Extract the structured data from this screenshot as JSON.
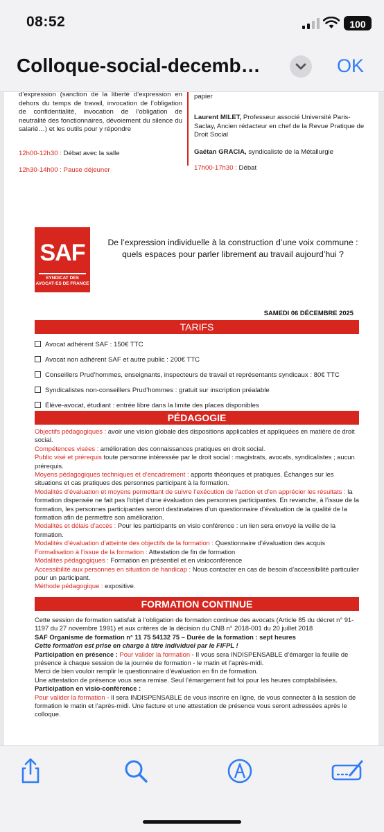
{
  "status": {
    "time": "08:52",
    "battery": "100"
  },
  "nav": {
    "title": "Colloque-social-decemb…",
    "ok_label": "OK"
  },
  "page1": {
    "left_text": "d’expression (sanction de la liberté d’expression en dehors du temps de travail, invocation de l’obligation de confidentialité, invocation de l’obligation de neutralité des fonctionnaires, dévoiement du silence du salarié…) et les outils pour y répondre",
    "slot1_time": "12h00-12h30 :",
    "slot1_label": " Débat avec la salle",
    "slot2": "12h30-14h00 : Pause déjeuner",
    "right_text": "accord avec l’employeur, au tract papier et à son affichage papier",
    "speaker1_name": "Laurent MILET,",
    "speaker1_desc": " Professeur associé Université Paris-Saclay, Ancien rédacteur en chef de la Revue Pratique de Droit Social",
    "speaker2_name": "Gaétan GRACIA,",
    "speaker2_desc": " syndicaliste de la Métallurgie",
    "slot3_time": "17h00-17h30 :",
    "slot3_label": " Débat"
  },
  "logo": {
    "big": "SAF",
    "line1": "SYNDICAT DES",
    "line2": "AVOCAT·ES DE FRANCE"
  },
  "headline": {
    "line1": "De l’expression individuelle à la construction d’une voix commune :",
    "line2": "quels espaces pour parler librement au travail aujourd’hui ?"
  },
  "date": "SAMEDI 06 DÉCEMBRE 2025",
  "tarifs": {
    "title": "TARIFS",
    "items": [
      "Avocat adhérent SAF : 150€ TTC",
      "Avocat non adhérent SAF et autre public : 200€ TTC",
      "Conseillers Prud’hommes, enseignants, inspecteurs de travail et représentants syndicaux : 80€ TTC",
      "Syndicalistes non-conseillers Prud’hommes : gratuit sur inscription préalable",
      "Élève-avocat, étudiant : entrée libre dans la limite des places disponibles"
    ]
  },
  "pedagogie": {
    "title": "PÉDAGOGIE",
    "items": [
      {
        "label": "Objectifs pédagogiques :",
        "text": " avoir une vision globale des dispositions applicables et appliquées en matière de droit social."
      },
      {
        "label": "Compétences visées :",
        "text": " amélioration des connaissances pratiques en droit social."
      },
      {
        "label": "Public visé et prérequis",
        "text": "  toute personne intéressée par le droit social : magistrats, avocats, syndicalistes ; aucun prérequis."
      },
      {
        "label": "Moyens pédagogiques techniques et d’encadrement :",
        "text": " apports théoriques et pratiques. Échanges sur les situations et cas pratiques des personnes participant à la formation."
      },
      {
        "label": "Modalités d’évaluation et moyens permettant de suivre l’exécution de l’action et d’en apprécier les résultats :",
        "text": " la formation dispensée ne fait pas l’objet d’une évaluation des personnes participantes. En revanche, à l’issue de la formation, les personnes participantes seront destinataires d’un questionnaire d’évaluation de la qualité de la formation afin de permettre son amélioration."
      },
      {
        "label": "Modalités et délais d’accès :",
        "text": " Pour les participants en visio conférence : un lien sera envoyé la veille de la formation."
      },
      {
        "label": "Modalités d’évaluation d’atteinte des objectifs de la formation :",
        "text": " Questionnaire d’évaluation des acquis"
      },
      {
        "label": "Formalisation à l’issue de la formation :",
        "text": " Attestation de fin de formation"
      },
      {
        "label": "Modalités pédagogiques :",
        "text": " Formation en présentiel et en visioconférence"
      },
      {
        "label": "Accessibilité aux personnes en situation de handicap :",
        "text": " Nous contacter en cas de besoin d’accessibilité particulier pour un participant."
      },
      {
        "label": "Méthode pédagogique :",
        "text": " expositive."
      }
    ]
  },
  "formation": {
    "title": "FORMATION CONTINUE",
    "intro": "Cette session de formation satisfait à l’obligation de formation continue des avocats (Article 85 du décret n° 91-1197 du 27 novembre 1991) et aux critères de la décision du CNB n° 2018-001 du 20 juillet 2018",
    "org": "SAF Organisme de formation n° 11 75 54132 75 – Durée de la formation : sept heures",
    "fifpl": "Cette formation est prise en charge à titre individuel par le FIFPL !",
    "presence_title": "Participation en présence :",
    "presence_link": "Pour valider la formation",
    "presence_text": " - Il vous sera INDISPENSABLE d’émarger la feuille de présence à chaque session de la journée de formation - le matin et l’après-midi.",
    "merci": "Merci de bien vouloir remplir le questionnaire d’évaluation en fin de formation.",
    "attestation": "Une attestation de présence vous sera remise. Seul l’émargement fait foi pour les heures comptabilisées.",
    "visio_title": "Participation en visio-conférence :",
    "visio_link": "Pour valider la formation",
    "visio_text": " - Il sera INDISPENSABLE de vous inscrire en ligne, de vous connecter à la session de formation le matin et l’après-midi. Une facture et une attestation de présence vous seront adressées après le colloque."
  },
  "colors": {
    "accent": "#d6261e",
    "link": "#2f7cf6"
  },
  "toolbar": {
    "icons": [
      "share-icon",
      "search-icon",
      "markup-icon",
      "signature-icon"
    ]
  }
}
